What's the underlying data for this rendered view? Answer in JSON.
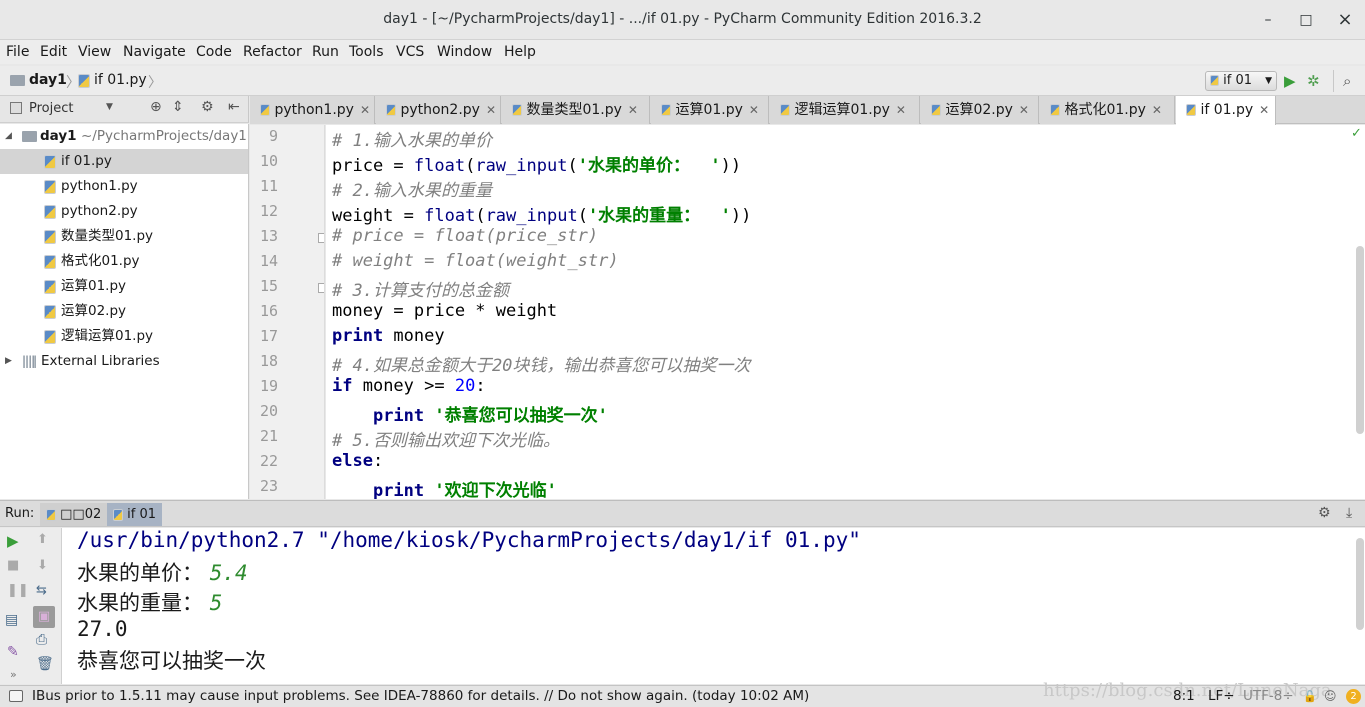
{
  "window": {
    "title": "day1 - [~/PycharmProjects/day1] - .../if 01.py - PyCharm Community Edition 2016.3.2",
    "minimize": "–",
    "maximize": "□",
    "close": "×"
  },
  "menu": [
    "File",
    "Edit",
    "View",
    "Navigate",
    "Code",
    "Refactor",
    "Run",
    "Tools",
    "VCS",
    "Window",
    "Help"
  ],
  "navbar": {
    "project": "day1",
    "file": "if 01.py",
    "run_config": "if 01",
    "run_icon": "play-icon",
    "debug_icon": "bug-icon",
    "search_icon": "search-icon"
  },
  "project_panel": {
    "title": "Project",
    "root_name": "day1",
    "root_path": "~/PycharmProjects/day1",
    "files": [
      "if 01.py",
      "python1.py",
      "python2.py",
      "数量类型01.py",
      "格式化01.py",
      "运算01.py",
      "运算02.py",
      "逻辑运算01.py"
    ],
    "external": "External Libraries"
  },
  "tabs": [
    "python1.py",
    "python2.py",
    "数量类型01.py",
    "运算01.py",
    "逻辑运算01.py",
    "运算02.py",
    "格式化01.py",
    "if 01.py"
  ],
  "editor": {
    "line_numbers": [
      "9",
      "10",
      "11",
      "12",
      "13",
      "14",
      "15",
      "16",
      "17",
      "18",
      "19",
      "20",
      "21",
      "22",
      "23"
    ],
    "lines": [
      [
        {
          "c": "cm",
          "t": "# 1.输入水果的单价"
        }
      ],
      [
        {
          "c": "",
          "t": "price = "
        },
        {
          "c": "fn",
          "t": "float"
        },
        {
          "c": "",
          "t": "("
        },
        {
          "c": "fn",
          "t": "raw_input"
        },
        {
          "c": "",
          "t": "("
        },
        {
          "c": "st",
          "t": "'水果的单价：  '"
        },
        {
          "c": "",
          "t": "))"
        }
      ],
      [
        {
          "c": "cm",
          "t": "# 2.输入水果的重量"
        }
      ],
      [
        {
          "c": "",
          "t": "weight = "
        },
        {
          "c": "fn",
          "t": "float"
        },
        {
          "c": "",
          "t": "("
        },
        {
          "c": "fn",
          "t": "raw_input"
        },
        {
          "c": "",
          "t": "("
        },
        {
          "c": "st",
          "t": "'水果的重量：  '"
        },
        {
          "c": "",
          "t": "))"
        }
      ],
      [
        {
          "c": "cm",
          "t": "# price = float(price_str)"
        }
      ],
      [
        {
          "c": "cm",
          "t": "# weight = float(weight_str)"
        }
      ],
      [
        {
          "c": "cm",
          "t": "# 3.计算支付的总金额"
        }
      ],
      [
        {
          "c": "",
          "t": "money = price * weight"
        }
      ],
      [
        {
          "c": "kw",
          "t": "print"
        },
        {
          "c": "",
          "t": " money"
        }
      ],
      [
        {
          "c": "cm",
          "t": "# 4.如果总金额大于20块钱，输出恭喜您可以抽奖一次"
        }
      ],
      [
        {
          "c": "kw",
          "t": "if"
        },
        {
          "c": "",
          "t": " money >= "
        },
        {
          "c": "nm",
          "t": "20"
        },
        {
          "c": "",
          "t": ":"
        }
      ],
      [
        {
          "c": "",
          "t": "    "
        },
        {
          "c": "kw",
          "t": "print"
        },
        {
          "c": "",
          "t": " "
        },
        {
          "c": "st",
          "t": "'恭喜您可以抽奖一次'"
        }
      ],
      [
        {
          "c": "cm",
          "t": "# 5.否则输出欢迎下次光临。"
        }
      ],
      [
        {
          "c": "kw",
          "t": "else"
        },
        {
          "c": "",
          "t": ":"
        }
      ],
      [
        {
          "c": "",
          "t": "    "
        },
        {
          "c": "kw",
          "t": "print"
        },
        {
          "c": "",
          "t": " "
        },
        {
          "c": "st",
          "t": "'欢迎下次光临'"
        }
      ]
    ]
  },
  "run": {
    "label": "Run:",
    "tabs": [
      "□□02",
      "if 01"
    ],
    "command": "/usr/bin/python2.7 \"/home/kiosk/PycharmProjects/day1/if 01.py\"",
    "prompt1": "水果的单价： ",
    "input1": "5.4",
    "prompt2": "水果的重量： ",
    "input2": "5",
    "result": "27.0",
    "message": "恭喜您可以抽奖一次"
  },
  "status": {
    "message": "IBus prior to 1.5.11 may cause input problems. See IDEA-78860 for details. // Do not show again. (today 10:02 AM)",
    "position": "8:1",
    "line_sep": "LF÷",
    "encoding": "UTF-8÷",
    "watermark": "https://blog.csdn.net/LuneNaga",
    "notifications": "2"
  }
}
